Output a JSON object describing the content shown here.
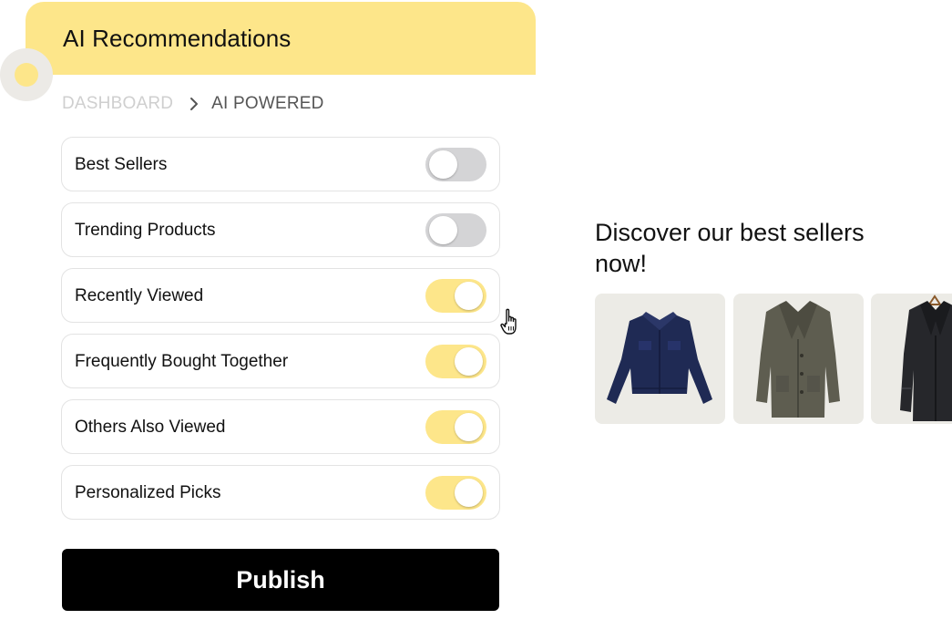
{
  "header": {
    "title": "AI Recommendations",
    "accent_color": "#fde68a"
  },
  "breadcrumb": {
    "root": "DASHBOARD",
    "separator_icon": "chevron-right-icon",
    "current": "AI POWERED"
  },
  "toggles": [
    {
      "label": "Best Sellers",
      "enabled": false
    },
    {
      "label": "Trending Products",
      "enabled": false
    },
    {
      "label": "Recently Viewed",
      "enabled": true
    },
    {
      "label": "Frequently Bought Together",
      "enabled": true
    },
    {
      "label": "Others Also Viewed",
      "enabled": true
    },
    {
      "label": "Personalized Picks",
      "enabled": true
    }
  ],
  "colors": {
    "toggle_on": "#fde68a",
    "toggle_off": "#d4d4d6",
    "publish_bg": "#000000"
  },
  "publish": {
    "label": "Publish"
  },
  "preview": {
    "title": "Discover our best sellers now!",
    "products": [
      {
        "icon": "navy-jacket-icon"
      },
      {
        "icon": "olive-coat-icon"
      },
      {
        "icon": "black-overcoat-icon"
      }
    ]
  }
}
